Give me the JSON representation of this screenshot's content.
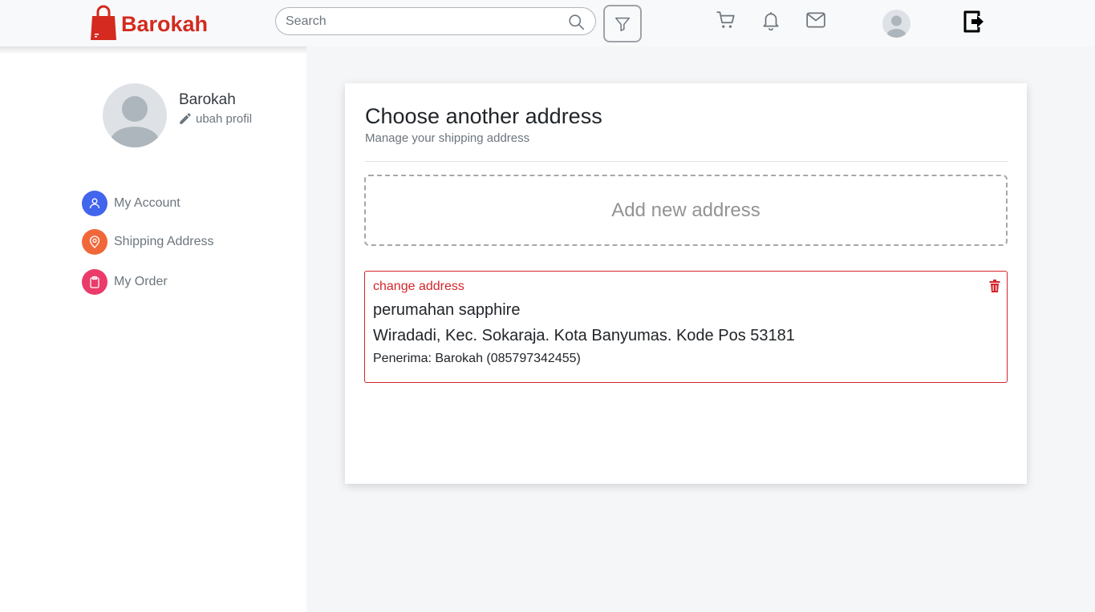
{
  "header": {
    "brand_name": "Barokah",
    "search": {
      "placeholder": "Search",
      "value": ""
    },
    "icons": [
      "search-icon",
      "filter-icon",
      "cart-icon",
      "bell-icon",
      "mail-icon",
      "user-avatar",
      "logout-icon"
    ],
    "colors": {
      "brand": "#d42a1f",
      "header_bg": "#f8f9fa"
    }
  },
  "sidebar": {
    "profile": {
      "name": "Barokah",
      "edit_label": "ubah profil"
    },
    "items": [
      {
        "label": "My Account",
        "icon": "user-icon",
        "color": "#4265ed"
      },
      {
        "label": "Shipping Address",
        "icon": "location-pin-icon",
        "color": "#f0683a"
      },
      {
        "label": "My Order",
        "icon": "clipboard-icon",
        "color": "#ea3b6a"
      }
    ]
  },
  "main": {
    "title": "Choose another address",
    "subtitle": "Manage your shipping address",
    "add_address_label": "Add new address",
    "address": {
      "change_label": "change address",
      "name": "perumahan sapphire",
      "line": "Wiradadi, Kec. Sokaraja. Kota Banyumas. Kode Pos 53181",
      "recipient": "Penerima: Barokah (085797342455)"
    },
    "colors": {
      "accent": "#d4252c"
    }
  }
}
